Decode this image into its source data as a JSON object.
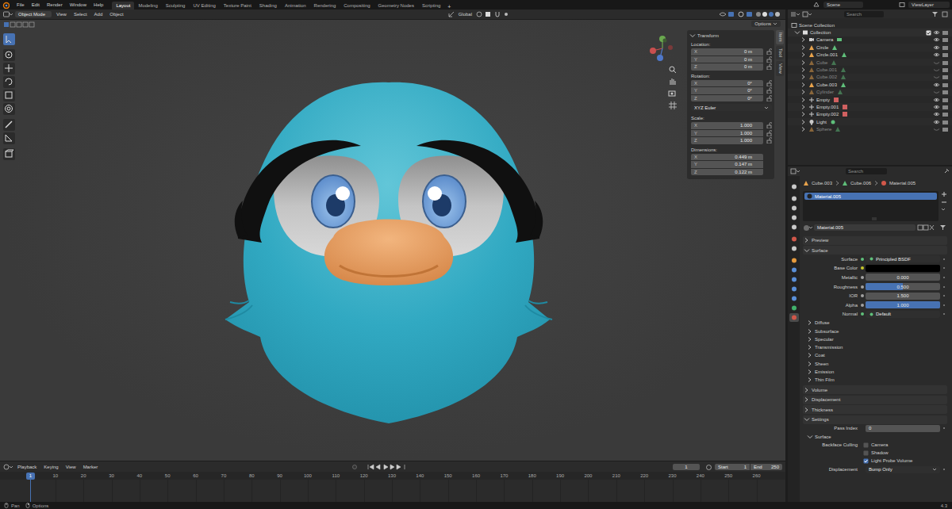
{
  "top_bar": {
    "menus": [
      "File",
      "Edit",
      "Render",
      "Window",
      "Help"
    ],
    "workspaces": [
      {
        "label": "Layout",
        "selected": true
      },
      {
        "label": "Modeling",
        "selected": false
      },
      {
        "label": "Sculpting",
        "selected": false
      },
      {
        "label": "UV Editing",
        "selected": false
      },
      {
        "label": "Texture Paint",
        "selected": false
      },
      {
        "label": "Shading",
        "selected": false
      },
      {
        "label": "Animation",
        "selected": false
      },
      {
        "label": "Rendering",
        "selected": false
      },
      {
        "label": "Compositing",
        "selected": false
      },
      {
        "label": "Geometry Nodes",
        "selected": false
      },
      {
        "label": "Scripting",
        "selected": false
      }
    ],
    "add_tab": "+",
    "scene": "Scene",
    "view_layer": "ViewLayer"
  },
  "viewport": {
    "mode": "Object Mode",
    "menus": [
      "View",
      "Select",
      "Add",
      "Object"
    ],
    "orientation": "Global",
    "options": "Options",
    "side_tabs": [
      "Item",
      "Tool",
      "View"
    ],
    "tools": [
      {
        "selected": true
      },
      {
        "selected": false
      },
      {
        "selected": false
      },
      {
        "selected": false
      },
      {
        "selected": false
      },
      {
        "selected": false
      },
      {
        "selected": false
      },
      {
        "selected": false
      },
      {
        "selected": false
      }
    ]
  },
  "transform": {
    "title": "Transform",
    "groups": [
      {
        "kind": "vector",
        "label": "Location:",
        "locked": false,
        "fields": [
          {
            "axis": "X",
            "value": "0 m"
          },
          {
            "axis": "Y",
            "value": "0 m"
          },
          {
            "axis": "Z",
            "value": "0 m"
          }
        ]
      },
      {
        "kind": "vector",
        "label": "Rotation:",
        "locked": false,
        "fields": [
          {
            "axis": "X",
            "value": "0°"
          },
          {
            "axis": "Y",
            "value": "0°"
          },
          {
            "axis": "Z",
            "value": "0°"
          }
        ]
      },
      {
        "kind": "select",
        "value": "XYZ Euler"
      },
      {
        "kind": "vector",
        "label": "Scale:",
        "locked": false,
        "fields": [
          {
            "axis": "X",
            "value": "1.000"
          },
          {
            "axis": "Y",
            "value": "1.000"
          },
          {
            "axis": "Z",
            "value": "1.000"
          }
        ]
      },
      {
        "kind": "vector",
        "label": "Dimensions:",
        "fields": [
          {
            "axis": "X",
            "value": "0.449 m"
          },
          {
            "axis": "Y",
            "value": "0.147 m"
          },
          {
            "axis": "Z",
            "value": "0.122 m"
          }
        ]
      }
    ]
  },
  "outliner": {
    "search_placeholder": "Search",
    "root": "Scene Collection",
    "collection": "Collection",
    "items": [
      {
        "name": "Camera",
        "kind": "camera",
        "hidden": false
      },
      {
        "name": "Circle",
        "kind": "mesh",
        "hidden": false
      },
      {
        "name": "Circle.001",
        "kind": "mesh",
        "hidden": false
      },
      {
        "name": "Cube",
        "kind": "mesh",
        "hidden": true
      },
      {
        "name": "Cube.001",
        "kind": "mesh",
        "hidden": true
      },
      {
        "name": "Cube.002",
        "kind": "mesh",
        "hidden": true
      },
      {
        "name": "Cube.003",
        "kind": "mesh",
        "hidden": false
      },
      {
        "name": "Cylinder",
        "kind": "mesh",
        "hidden": true
      },
      {
        "name": "Empty",
        "kind": "empty",
        "hidden": false
      },
      {
        "name": "Empty.001",
        "kind": "empty",
        "hidden": false
      },
      {
        "name": "Empty.002",
        "kind": "empty",
        "hidden": false
      },
      {
        "name": "Light",
        "kind": "light",
        "hidden": false
      },
      {
        "name": "Sphere",
        "kind": "mesh",
        "hidden": true
      }
    ]
  },
  "properties": {
    "search_placeholder": "Search",
    "breadcrumb": [
      "Cube.003",
      "Cube.006",
      "Material.005"
    ],
    "editor_tabs": [
      {
        "color": "#c8c8c8",
        "selected": false
      },
      {
        "color": "#c8c8c8",
        "selected": false
      },
      {
        "color": "#c8c8c8",
        "selected": false
      },
      {
        "color": "#c8c8c8",
        "selected": false
      },
      {
        "color": "#c8c8c8",
        "selected": false
      },
      {
        "color": "#d0574a",
        "selected": false
      },
      {
        "color": "#c8c8c8",
        "selected": false
      },
      {
        "color": "#e69a3c",
        "selected": false
      },
      {
        "color": "#5a8fd8",
        "selected": false
      },
      {
        "color": "#5a8fd8",
        "selected": false
      },
      {
        "color": "#5a8fd8",
        "selected": false
      },
      {
        "color": "#5a8fd8",
        "selected": false
      },
      {
        "color": "#41b06b",
        "selected": false
      },
      {
        "color": "#d0574a",
        "selected": true
      }
    ],
    "slots": [
      {
        "name": "Material.005",
        "selected": true
      }
    ],
    "material": "Material.005",
    "rows": [
      {
        "kind": "section",
        "label": "Preview",
        "expanded": false
      },
      {
        "kind": "section",
        "label": "Surface",
        "expanded": true
      },
      {
        "kind": "shader",
        "label": "Surface",
        "value": "Principled BSDF"
      },
      {
        "kind": "color",
        "label": "Base Color",
        "color": "#000000"
      },
      {
        "kind": "slider",
        "label": "Metallic",
        "value": "0.000",
        "level": 0
      },
      {
        "kind": "slider",
        "label": "Roughness",
        "value": "0.500",
        "level": 0.5
      },
      {
        "kind": "slider",
        "label": "IOR",
        "value": "1.500",
        "level": 0
      },
      {
        "kind": "slider",
        "label": "Alpha",
        "value": "1.000",
        "level": 1
      },
      {
        "kind": "shader",
        "label": "Normal",
        "value": "Default"
      },
      {
        "kind": "subsection",
        "label": "Diffuse",
        "expanded": false
      },
      {
        "kind": "subsection",
        "label": "Subsurface",
        "expanded": false
      },
      {
        "kind": "subsection",
        "label": "Specular",
        "expanded": false
      },
      {
        "kind": "subsection",
        "label": "Transmission",
        "expanded": false
      },
      {
        "kind": "subsection",
        "label": "Coat",
        "expanded": false
      },
      {
        "kind": "subsection",
        "label": "Sheen",
        "expanded": false
      },
      {
        "kind": "subsection",
        "label": "Emission",
        "expanded": false
      },
      {
        "kind": "subsection",
        "label": "Thin Film",
        "expanded": false
      },
      {
        "kind": "section",
        "label": "Volume",
        "expanded": false
      },
      {
        "kind": "section",
        "label": "Displacement",
        "expanded": false
      },
      {
        "kind": "section",
        "label": "Thickness",
        "expanded": false
      },
      {
        "kind": "section",
        "label": "Settings",
        "expanded": true
      },
      {
        "kind": "field",
        "label": "Pass Index",
        "value": "0"
      },
      {
        "kind": "subsection",
        "label": "Surface",
        "expanded": true
      },
      {
        "kind": "checkbox",
        "label": "Backface Culling",
        "option": "Camera",
        "checked": false
      },
      {
        "kind": "checkbox",
        "label": "",
        "option": "Shadow",
        "checked": false
      },
      {
        "kind": "checkbox",
        "label": "",
        "option": "Light Probe Volume",
        "checked": true
      },
      {
        "kind": "select",
        "label": "Displacement",
        "value": "Bump Only"
      }
    ]
  },
  "timeline": {
    "menus": [
      "Playback",
      "Keying",
      "View",
      "Marker"
    ],
    "current_frame": "1",
    "start_label": "Start",
    "start": "1",
    "end_label": "End",
    "end": "250",
    "playhead": "1",
    "ticks": [
      "10",
      "20",
      "30",
      "40",
      "50",
      "60",
      "70",
      "80",
      "90",
      "100",
      "110",
      "120",
      "130",
      "140",
      "150",
      "160",
      "170",
      "180",
      "190",
      "200",
      "210",
      "220",
      "230",
      "240",
      "250",
      "260"
    ]
  },
  "status_bar": {
    "items": [
      "Pan",
      "Options"
    ],
    "version": "4.3"
  }
}
